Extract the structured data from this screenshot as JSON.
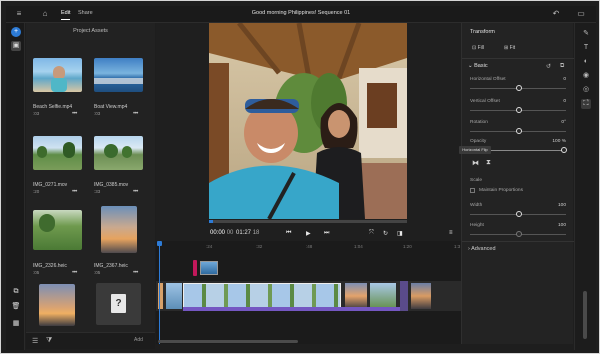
{
  "topbar": {
    "tabs": [
      {
        "label": "Edit"
      },
      {
        "label": "Share"
      }
    ],
    "title": "Good morning Philippines! Sequence 01",
    "icons": {
      "home": "home-icon",
      "undo": "undo-icon",
      "chat": "chat-icon"
    }
  },
  "assets": {
    "title": "Project Assets",
    "items": [
      {
        "name": "Beach Selfie.mp4",
        "duration": ":03"
      },
      {
        "name": "Boat View.mp4",
        "duration": ":03"
      },
      {
        "name": "IMG_0271.mov",
        "duration": ":20"
      },
      {
        "name": "IMG_0385.mov",
        "duration": ":33"
      },
      {
        "name": "IMG_2326.heic",
        "duration": ":05"
      },
      {
        "name": "IMG_2367.heic",
        "duration": ":05"
      }
    ],
    "more_label": "•••",
    "add_label": "Add"
  },
  "viewer": {
    "timecode_current": "00:00",
    "timecode_frames": "00",
    "timecode_total": "01:27",
    "timecode_total_frames": "18",
    "playhead_progress": 0.02
  },
  "timeline": {
    "ticks": [
      ":24",
      ":32",
      ":48",
      "1:04",
      "1:20",
      "1:3"
    ]
  },
  "inspector": {
    "title": "Transform",
    "fill_label": "Fill",
    "fit_label": "Fit",
    "section_basic": "Basic",
    "h_offset_label": "Horizontal Offset",
    "h_offset_value": "0",
    "v_offset_label": "Vertical Offset",
    "v_offset_value": "0",
    "rotation_label": "Rotation",
    "rotation_value": "0°",
    "opacity_label": "Opacity",
    "opacity_value": "100 %",
    "tooltip": "Horizontal Flip",
    "scale_label": "Scale",
    "maintain_label": "Maintain Proportions",
    "width_label": "Width",
    "width_value": "100",
    "height_label": "Height",
    "height_value": "100",
    "section_advanced": "Advanced"
  },
  "colors": {
    "accent": "#2d7bd6",
    "audio": "#7457c2",
    "marker": "#c2185b"
  }
}
